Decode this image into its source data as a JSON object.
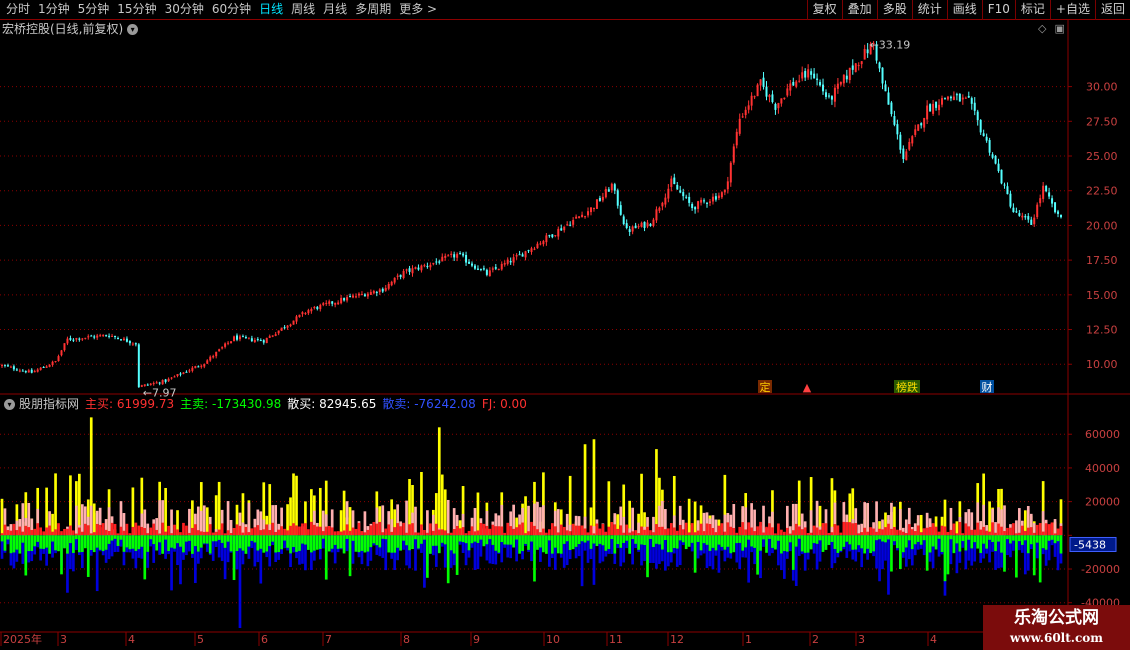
{
  "toolbar": {
    "periods": [
      {
        "label": "分时",
        "active": false
      },
      {
        "label": "1分钟",
        "active": false
      },
      {
        "label": "5分钟",
        "active": false
      },
      {
        "label": "15分钟",
        "active": false
      },
      {
        "label": "30分钟",
        "active": false
      },
      {
        "label": "60分钟",
        "active": false
      },
      {
        "label": "日线",
        "active": true
      },
      {
        "label": "周线",
        "active": false
      },
      {
        "label": "月线",
        "active": false
      },
      {
        "label": "多周期",
        "active": false
      },
      {
        "label": "更多 >",
        "active": false
      }
    ],
    "buttons": [
      "复权",
      "叠加",
      "多股",
      "统计",
      "画线",
      "F10",
      "标记",
      "+自选",
      "返回"
    ]
  },
  "main_panel": {
    "title": "宏桥控股(日线,前复权)",
    "price_axis": [
      "30.00",
      "27.50",
      "25.00",
      "22.50",
      "20.00",
      "17.50",
      "15.00",
      "12.50",
      "10.00"
    ],
    "high_label": "33.19",
    "low_label": "7.97",
    "event_markers": [
      {
        "label": "定",
        "color": "#ffcc00",
        "bg": "#7a2a00"
      },
      {
        "label": "▲",
        "color": "#ff4040",
        "bg": ""
      },
      {
        "label": "榜跌",
        "color": "#ffdd00",
        "bg": "#2a5a00"
      },
      {
        "label": "财",
        "color": "#ffffff",
        "bg": "#0050a0"
      }
    ]
  },
  "indicator_panel": {
    "name": "股朋指标网",
    "values": [
      {
        "label": "主买: 61999.73",
        "color": "#ff3030"
      },
      {
        "label": "主卖: -173430.98",
        "color": "#00ff00"
      },
      {
        "label": "散买: 82945.65",
        "color": "#ffffff"
      },
      {
        "label": "散卖: -76242.08",
        "color": "#3050ff"
      },
      {
        "label": "FJ: 0.00",
        "color": "#ff3030"
      }
    ],
    "axis": [
      "60000",
      "40000",
      "20000",
      "0",
      "-20000",
      "-40000"
    ],
    "current_value": "-5438"
  },
  "time_axis": [
    "2025年",
    "3",
    "4",
    "5",
    "6",
    "7",
    "8",
    "9",
    "10",
    "11",
    "12",
    "1",
    "2",
    "3",
    "4"
  ],
  "watermark": {
    "title": "乐淘公式网",
    "url": "www.60lt.com"
  },
  "colors": {
    "up": "#ff3232",
    "down": "#54ffff",
    "grid": "#8b0000",
    "axis_text": "#c84040",
    "main_buy": "#ff2020",
    "main_sell": "#00ff00",
    "retail_buy": "#ffff00",
    "retail_sell": "#0000dd",
    "pink": "#ffb0b0"
  },
  "chart_data": [
    {
      "type": "candlestick",
      "title": "宏桥控股(日线,前复权)",
      "ylim": [
        8,
        33.5
      ],
      "price_path": [
        [
          0,
          9.9
        ],
        [
          10,
          9.4
        ],
        [
          18,
          10.2
        ],
        [
          22,
          11.8
        ],
        [
          36,
          12.1
        ],
        [
          45,
          11.5
        ],
        [
          46,
          8.4
        ],
        [
          55,
          8.8
        ],
        [
          68,
          10.1
        ],
        [
          78,
          11.9
        ],
        [
          88,
          11.7
        ],
        [
          103,
          13.9
        ],
        [
          115,
          14.7
        ],
        [
          128,
          15.4
        ],
        [
          135,
          16.6
        ],
        [
          145,
          17.3
        ],
        [
          153,
          17.9
        ],
        [
          163,
          16.5
        ],
        [
          173,
          17.7
        ],
        [
          188,
          19.8
        ],
        [
          198,
          21.2
        ],
        [
          202,
          22.1
        ],
        [
          205,
          22.9
        ],
        [
          210,
          19.6
        ],
        [
          218,
          20.2
        ],
        [
          225,
          23.1
        ],
        [
          232,
          21.3
        ],
        [
          243,
          22.4
        ],
        [
          248,
          27.7
        ],
        [
          255,
          30.2
        ],
        [
          260,
          28.6
        ],
        [
          265,
          30.1
        ],
        [
          272,
          31.1
        ],
        [
          278,
          29.0
        ],
        [
          286,
          31.4
        ],
        [
          293,
          33.1
        ],
        [
          296,
          30.2
        ],
        [
          303,
          24.9
        ],
        [
          311,
          28.4
        ],
        [
          318,
          29.3
        ],
        [
          325,
          28.9
        ],
        [
          332,
          25.5
        ],
        [
          340,
          21.0
        ],
        [
          346,
          20.1
        ],
        [
          350,
          22.7
        ],
        [
          355,
          20.6
        ]
      ],
      "high_value": 33.19,
      "low_value": 7.97
    },
    {
      "type": "bar",
      "title": "股朋指标网",
      "ylim": [
        -55000,
        72000
      ],
      "series": [
        {
          "name": "主买",
          "color": "#ff2020"
        },
        {
          "name": "主卖",
          "color": "#00ff00"
        },
        {
          "name": "散买",
          "color": "#ffff00"
        },
        {
          "name": "散卖",
          "color": "#0000dd"
        }
      ],
      "last_values": {
        "主买": 61999.73,
        "主卖": -173430.98,
        "散买": 82945.65,
        "散卖": -76242.08,
        "FJ": 0.0
      }
    }
  ]
}
